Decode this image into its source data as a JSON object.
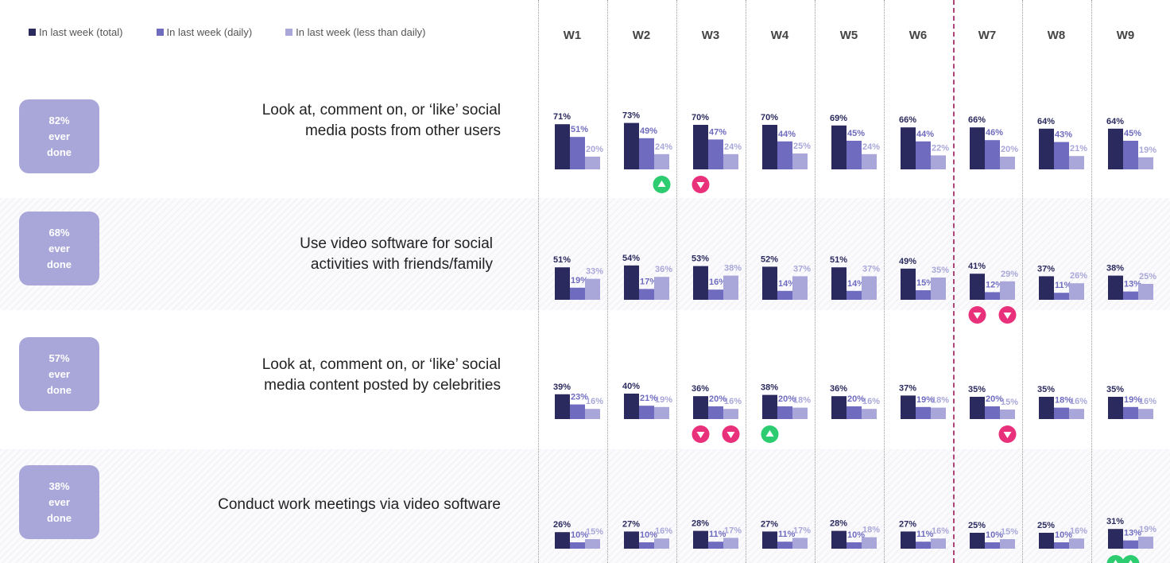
{
  "legend": [
    {
      "label": "In last week (total)",
      "color": "#2b2a5e"
    },
    {
      "label": "In last week (daily)",
      "color": "#6f6cc0"
    },
    {
      "label": "In last week (less than daily)",
      "color": "#a9a7d9"
    }
  ],
  "weeks": [
    "W1",
    "W2",
    "W3",
    "W4",
    "W5",
    "W6",
    "W7",
    "W8",
    "W9"
  ],
  "rows": [
    {
      "ever_value": "82%",
      "ever_line2": "ever",
      "ever_line3": "done",
      "question_line1": "Look at, comment on, or ‘like’ social",
      "question_line2": "media posts from other users"
    },
    {
      "ever_value": "68%",
      "ever_line2": "ever",
      "ever_line3": "done",
      "question_line1": "Use video software for social",
      "question_line2": "activities with friends/family"
    },
    {
      "ever_value": "57%",
      "ever_line2": "ever",
      "ever_line3": "done",
      "question_line1": "Look at, comment on, or ‘like’ social",
      "question_line2": "media content posted by celebrities"
    },
    {
      "ever_value": "38%",
      "ever_line2": "ever",
      "ever_line3": "done",
      "question_line1": "Conduct work meetings via video software",
      "question_line2": ""
    }
  ],
  "chart_data": {
    "type": "bar",
    "categories": [
      "W1",
      "W2",
      "W3",
      "W4",
      "W5",
      "W6",
      "W7",
      "W8",
      "W9"
    ],
    "series_names": [
      "In last week (total)",
      "In last week (daily)",
      "In last week (less than daily)"
    ],
    "colors": {
      "total": "#2b2a5e",
      "daily": "#6f6cc0",
      "less": "#a9a7d9",
      "up": "#2ecc71",
      "down": "#e8317a"
    },
    "panels": [
      {
        "total": [
          71,
          73,
          70,
          70,
          69,
          66,
          66,
          64,
          64
        ],
        "daily": [
          51,
          49,
          47,
          44,
          45,
          44,
          46,
          43,
          45
        ],
        "less": [
          20,
          24,
          24,
          25,
          24,
          22,
          20,
          21,
          19
        ],
        "markers": [
          {
            "week": 1,
            "series": "less",
            "dir": "up"
          },
          {
            "week": 2,
            "series": "total",
            "dir": "down"
          }
        ]
      },
      {
        "total": [
          51,
          54,
          53,
          52,
          51,
          49,
          41,
          37,
          38
        ],
        "daily": [
          19,
          17,
          16,
          14,
          14,
          15,
          12,
          11,
          13
        ],
        "less": [
          33,
          36,
          38,
          37,
          37,
          35,
          29,
          26,
          25
        ],
        "markers": [
          {
            "week": 6,
            "series": "total",
            "dir": "down"
          },
          {
            "week": 6,
            "series": "less",
            "dir": "down"
          }
        ]
      },
      {
        "total": [
          39,
          40,
          36,
          38,
          36,
          37,
          35,
          35,
          35
        ],
        "daily": [
          23,
          21,
          20,
          20,
          20,
          19,
          20,
          18,
          19
        ],
        "less": [
          16,
          19,
          16,
          18,
          16,
          18,
          15,
          16,
          16
        ],
        "markers": [
          {
            "week": 2,
            "series": "total",
            "dir": "down"
          },
          {
            "week": 2,
            "series": "less",
            "dir": "down"
          },
          {
            "week": 3,
            "series": "total",
            "dir": "up"
          },
          {
            "week": 6,
            "series": "less",
            "dir": "down"
          }
        ]
      },
      {
        "total": [
          26,
          27,
          28,
          27,
          28,
          27,
          25,
          25,
          31
        ],
        "daily": [
          10,
          10,
          11,
          11,
          10,
          11,
          10,
          10,
          13
        ],
        "less": [
          15,
          16,
          17,
          17,
          18,
          16,
          15,
          16,
          19
        ],
        "markers": [
          {
            "week": 8,
            "series": "total",
            "dir": "up"
          },
          {
            "week": 8,
            "series": "daily",
            "dir": "up"
          }
        ]
      }
    ]
  }
}
